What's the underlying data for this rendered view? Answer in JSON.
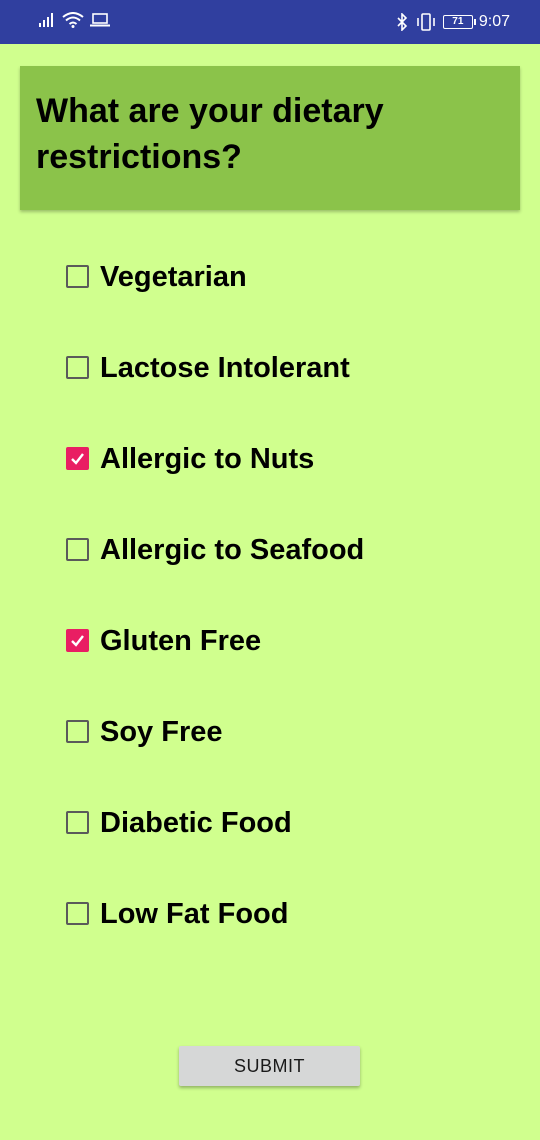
{
  "status_bar": {
    "time": "9:07",
    "battery_level": "71",
    "icons_left": [
      "signal-icon",
      "wifi-icon",
      "laptop-icon"
    ],
    "icons_right": [
      "bluetooth-icon",
      "vibrate-icon",
      "battery-icon"
    ]
  },
  "header": {
    "title": "What are your dietary restrictions?"
  },
  "options": [
    {
      "label": "Vegetarian",
      "checked": false
    },
    {
      "label": "Lactose Intolerant",
      "checked": false
    },
    {
      "label": "Allergic to Nuts",
      "checked": true
    },
    {
      "label": "Allergic to Seafood",
      "checked": false
    },
    {
      "label": "Gluten Free",
      "checked": true
    },
    {
      "label": "Soy Free",
      "checked": false
    },
    {
      "label": "Diabetic Food",
      "checked": false
    },
    {
      "label": "Low Fat Food",
      "checked": false
    }
  ],
  "submit": {
    "label": "SUBMIT"
  },
  "colors": {
    "status_bar": "#303f9f",
    "background": "#d0ff8e",
    "header_card": "#8bc34a",
    "checkbox_checked": "#e91e63",
    "button": "#d6d7d7"
  }
}
